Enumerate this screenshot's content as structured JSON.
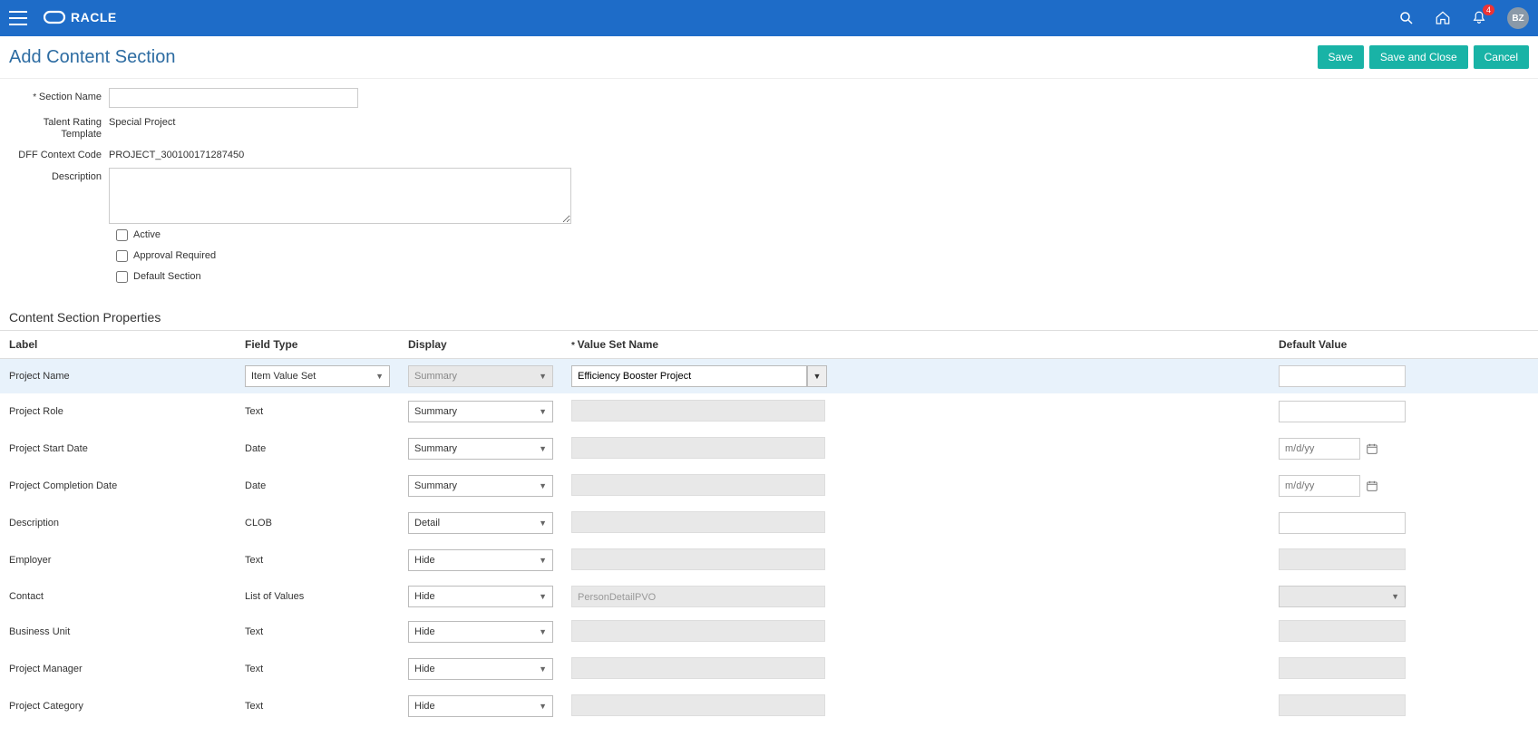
{
  "header": {
    "notifications_count": "4",
    "avatar_initials": "BZ"
  },
  "page": {
    "title": "Add Content Section"
  },
  "actions": {
    "save": "Save",
    "save_and_close": "Save and Close",
    "cancel": "Cancel"
  },
  "form": {
    "section_name_label": "Section Name",
    "section_name_value": "",
    "talent_rating_template_label": "Talent Rating Template",
    "talent_rating_template_value": "Special Project",
    "dff_context_code_label": "DFF Context Code",
    "dff_context_code_value": "PROJECT_300100171287450",
    "description_label": "Description",
    "description_value": "",
    "active_label": "Active",
    "approval_required_label": "Approval Required",
    "default_section_label": "Default Section"
  },
  "props_section": {
    "title": "Content Section Properties",
    "columns": {
      "label": "Label",
      "field_type": "Field Type",
      "display": "Display",
      "value_set_name": "Value Set Name",
      "default_value": "Default Value"
    },
    "rows": [
      {
        "label": "Project Name",
        "field_type": "Item Value Set",
        "field_type_editable": true,
        "display": "Summary",
        "display_disabled": true,
        "value_set_name": "Efficiency Booster Project",
        "value_set_editable": true,
        "default_type": "text",
        "default_placeholder": "",
        "selected": true
      },
      {
        "label": "Project Role",
        "field_type": "Text",
        "field_type_editable": false,
        "display": "Summary",
        "display_disabled": false,
        "value_set_editable": false,
        "default_type": "text",
        "default_placeholder": ""
      },
      {
        "label": "Project Start Date",
        "field_type": "Date",
        "field_type_editable": false,
        "display": "Summary",
        "display_disabled": false,
        "value_set_editable": false,
        "default_type": "date",
        "default_placeholder": "m/d/yy"
      },
      {
        "label": "Project Completion Date",
        "field_type": "Date",
        "field_type_editable": false,
        "display": "Summary",
        "display_disabled": false,
        "value_set_editable": false,
        "default_type": "date",
        "default_placeholder": "m/d/yy"
      },
      {
        "label": "Description",
        "field_type": "CLOB",
        "field_type_editable": false,
        "display": "Detail",
        "display_disabled": false,
        "value_set_editable": false,
        "default_type": "text",
        "default_placeholder": ""
      },
      {
        "label": "Employer",
        "field_type": "Text",
        "field_type_editable": false,
        "display": "Hide",
        "display_disabled": false,
        "value_set_editable": false,
        "default_type": "gray",
        "default_placeholder": ""
      },
      {
        "label": "Contact",
        "field_type": "List of Values",
        "field_type_editable": false,
        "display": "Hide",
        "display_disabled": false,
        "value_set_name": "PersonDetailPVO",
        "value_set_editable": false,
        "value_set_text": true,
        "default_type": "gray-dropdown",
        "default_placeholder": ""
      },
      {
        "label": "Business Unit",
        "field_type": "Text",
        "field_type_editable": false,
        "display": "Hide",
        "display_disabled": false,
        "value_set_editable": false,
        "default_type": "gray",
        "default_placeholder": ""
      },
      {
        "label": "Project Manager",
        "field_type": "Text",
        "field_type_editable": false,
        "display": "Hide",
        "display_disabled": false,
        "value_set_editable": false,
        "default_type": "gray",
        "default_placeholder": ""
      },
      {
        "label": "Project Category",
        "field_type": "Text",
        "field_type_editable": false,
        "display": "Hide",
        "display_disabled": false,
        "value_set_editable": false,
        "default_type": "gray",
        "default_placeholder": ""
      }
    ]
  }
}
